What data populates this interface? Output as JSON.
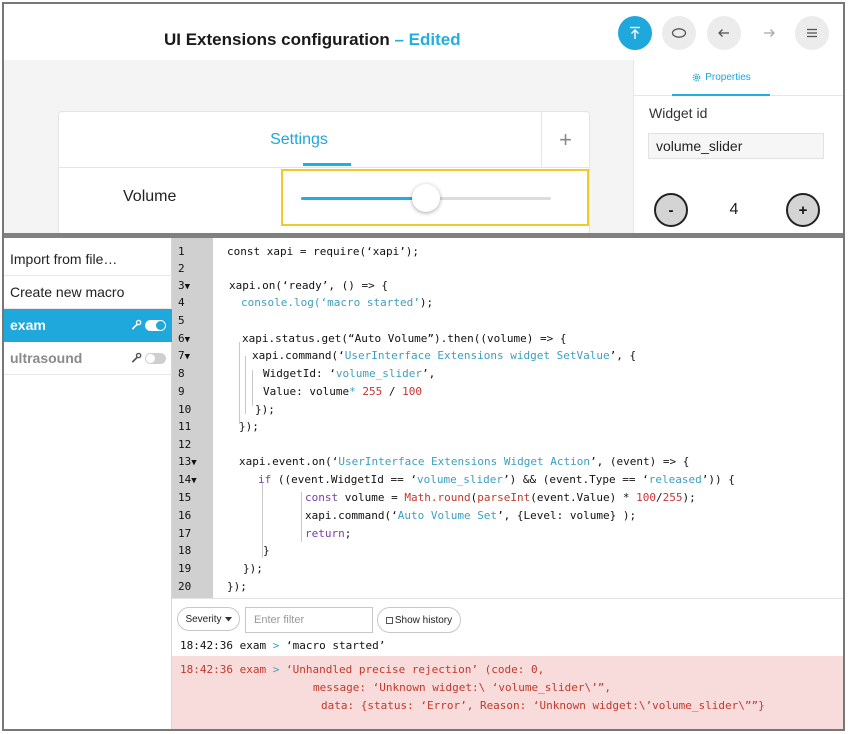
{
  "header": {
    "title": "UI Extensions configuration",
    "separator": " – ",
    "edited": "Edited",
    "icons": [
      "upload-icon",
      "eye-icon",
      "undo-icon",
      "redo-icon",
      "menu-icon"
    ]
  },
  "editor": {
    "tab_label": "Settings",
    "add_tab": "+",
    "row_label": "Volume",
    "slider_value_fraction": 0.5
  },
  "properties": {
    "tab_label": "Properties",
    "widget_id_label": "Widget id",
    "widget_id_value": "volume_slider",
    "minus": "-",
    "value": "4",
    "plus": "+"
  },
  "sidebar": {
    "import_label": "Import from file…",
    "create_label": "Create new macro",
    "macros": [
      {
        "name": "exam",
        "active": true,
        "enabled": true
      },
      {
        "name": "ultrasound",
        "active": false,
        "enabled": false
      }
    ]
  },
  "code": {
    "line_numbers": [
      "1",
      "2",
      "3",
      "4",
      "5",
      "6",
      "7",
      "8",
      "9",
      "10",
      "11",
      "12",
      "13",
      "14",
      "15",
      "16",
      "17",
      "18",
      "19",
      "20"
    ],
    "fold_marker": "▼",
    "lines": [
      {
        "c": "const xapi = require(‘xapi’);"
      },
      {
        "c": ""
      },
      {
        "c": "xapi.on(‘ready’, () => {"
      },
      {
        "c": "console.log(",
        "s": "‘macro started’",
        "e": ");"
      },
      {
        "c": ""
      },
      {
        "c": "xapi.status.get(“Auto Volume”).then((volume) => {"
      },
      {
        "c": "xapi.command(‘",
        "s": "UserInterface Extensions widget SetValue",
        "e": "’, {"
      },
      {
        "c": "WidgetId: ‘",
        "s": "volume_slider",
        "e": "’,"
      },
      {
        "c": "Value: volume",
        "op": "*",
        "n1": "255",
        "sl": "/",
        "n2": "100"
      },
      {
        "c": "});"
      },
      {
        "c": "});"
      },
      {
        "c": ""
      },
      {
        "c": "xapi.event.on(‘",
        "s": "UserInterface Extensions Widget Action",
        "e": "’, (event) => {"
      },
      {
        "kw": "if",
        "c": " ((event.WidgetId == ‘",
        "s": "volume_slider",
        "c2": "’) && (event.Type == ‘",
        "s2": "released",
        "e": "’)) {"
      },
      {
        "kw": "const",
        "c": " volume = ",
        "f1": "Math.round",
        "c2": "(",
        "f2": "parseInt",
        "c3": "(event.Value) * ",
        "n1": "100",
        "sl": "/",
        "n2": "255",
        "e": ");"
      },
      {
        "c": "xapi.command(‘",
        "s": "Auto Volume Set",
        "e": "’, {Level: volume} );"
      },
      {
        "kw": "return",
        "e": ";"
      },
      {
        "c": "}"
      },
      {
        "c": "});"
      },
      {
        "c": "});"
      }
    ]
  },
  "log": {
    "severity_label": "Severity",
    "filter_placeholder": "Enter filter",
    "show_history_label": "Show history",
    "entries": [
      {
        "time": "18:42:36",
        "source": "exam",
        "arrow": ">",
        "message": "‘macro started’",
        "level": "info"
      },
      {
        "time": "18:42:36",
        "source": "exam",
        "arrow": ">",
        "message": "‘Unhandled precise rejection’ (code: 0,",
        "level": "error",
        "continuation": [
          "message: ‘Unknown widget:\\ ‘volume_slider\\’”,",
          "data: {status: ‘Error’, Reason: ‘Unknown widget:\\’volume_slider\\””}"
        ]
      }
    ]
  },
  "colors": {
    "accent": "#1ea8dc",
    "highlight_border": "#f0c92d",
    "error_bg": "#f8dcdc",
    "error_text": "#c0392b"
  }
}
